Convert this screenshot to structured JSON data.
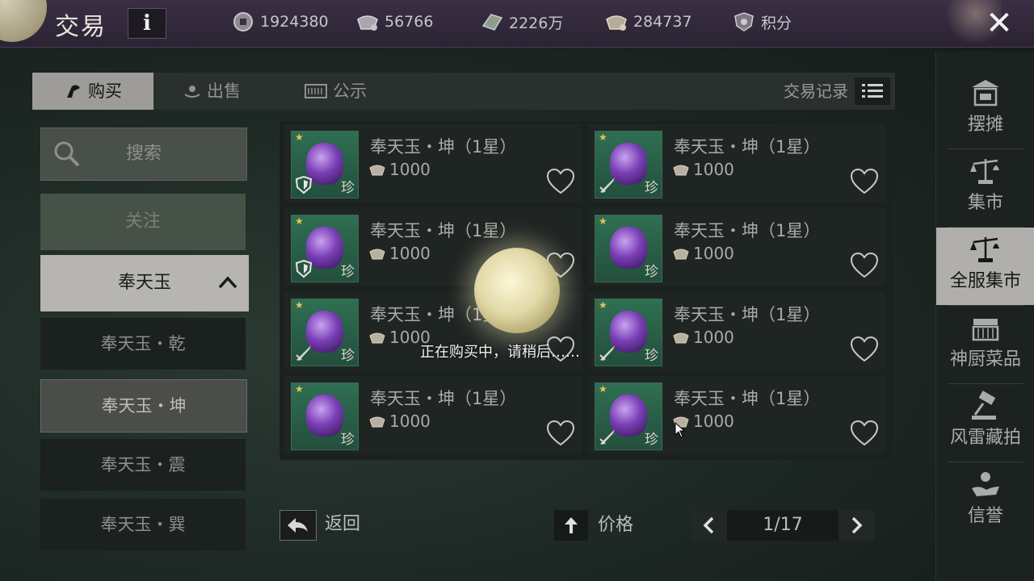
{
  "header": {
    "title": "交易",
    "info_label": "i",
    "currencies": [
      {
        "icon": "silver-coin-icon",
        "value": "1924380"
      },
      {
        "icon": "ingot-icon",
        "value": "56766"
      },
      {
        "icon": "jade-icon",
        "value": "2226万"
      },
      {
        "icon": "gold-ingot-icon",
        "value": "284737"
      },
      {
        "icon": "points-shield-icon",
        "value": "积分"
      }
    ],
    "close_label": "✕"
  },
  "tabs": {
    "buy": "购买",
    "sell": "出售",
    "notice": "公示",
    "trade_log": "交易记录"
  },
  "left": {
    "search": "搜索",
    "follow": "关注",
    "category": "奉天玉",
    "sub_items": [
      "奉天玉・乾",
      "奉天玉・坤",
      "奉天玉・震",
      "奉天玉・巽"
    ],
    "selected_index": 1
  },
  "items": [
    {
      "name": "奉天玉・坤（1星）",
      "price": "1000",
      "badge": "shield"
    },
    {
      "name": "奉天玉・坤（1星）",
      "price": "1000",
      "badge": "sword"
    },
    {
      "name": "奉天玉・坤（1星）",
      "price": "1000",
      "badge": "shield"
    },
    {
      "name": "奉天玉・坤（1星）",
      "price": "1000",
      "badge": "none"
    },
    {
      "name": "奉天玉・坤（1星）",
      "price": "1000",
      "badge": "sword"
    },
    {
      "name": "奉天玉・坤（1星）",
      "price": "1000",
      "badge": "sword"
    },
    {
      "name": "奉天玉・坤（1星）",
      "price": "1000",
      "badge": "none"
    },
    {
      "name": "奉天玉・坤（1星）",
      "price": "1000",
      "badge": "sword"
    }
  ],
  "item_tag": "珍",
  "bottom": {
    "back": "返回",
    "sort": "价格",
    "page": "1/17"
  },
  "sidenav": [
    {
      "label": "摆摊",
      "icon": "stall-icon"
    },
    {
      "label": "集市",
      "icon": "scale-icon"
    },
    {
      "label": "全服集市",
      "icon": "scale-icon"
    },
    {
      "label": "神厨菜品",
      "icon": "kitchen-icon"
    },
    {
      "label": "风雷藏拍",
      "icon": "gavel-icon"
    },
    {
      "label": "信誉",
      "icon": "hand-icon"
    }
  ],
  "active_nav": 2,
  "overlay": {
    "text": "正在购买中，请稍后……"
  },
  "colors": {
    "topbar": "#3a2f43",
    "active_tab": "#9e9c99",
    "gem": "#7a3fb6",
    "thumb_bg": "#2f6f52"
  }
}
